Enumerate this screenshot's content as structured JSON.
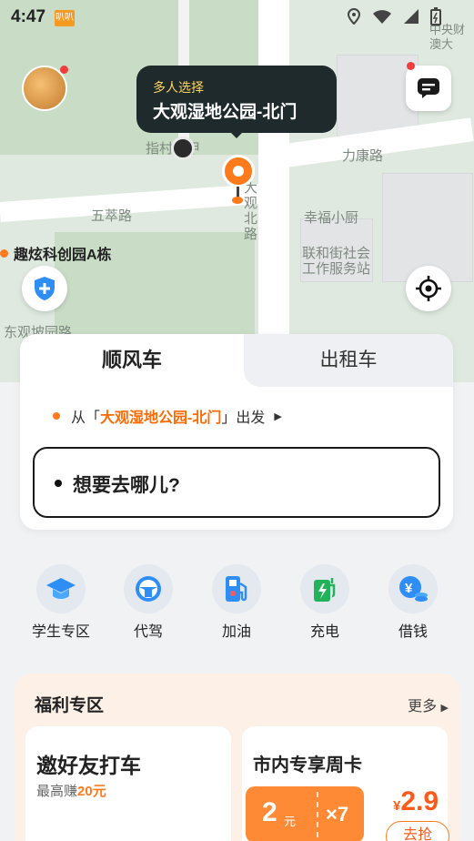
{
  "status_bar": {
    "time": "4:47",
    "notif_label": "叭叭"
  },
  "map": {
    "labels": {
      "road_likang": "力康路",
      "road_daguan": "大观北路",
      "road_left": "五萃路",
      "place_top_right": "中央财澳大",
      "place_xingfu": "幸福小厨",
      "place_lianhe": "联和街社会工作服务站",
      "place_zhicun": "指村美甲",
      "place_bottom_left": "东观坡园路"
    },
    "bubble": {
      "subtitle": "多人选择",
      "title": "大观湿地公园-北门"
    },
    "poi_label": "趣炫科创园A栋"
  },
  "ride_card": {
    "tabs": [
      "顺风车",
      "出租车"
    ],
    "from_prefix": "从「",
    "from_place": "大观湿地公园-北门",
    "from_suffix": "」出发",
    "destination_placeholder": "想要去哪儿?"
  },
  "services": [
    {
      "label": "学生专区",
      "icon": "graduation-cap-icon"
    },
    {
      "label": "代驾",
      "icon": "steering-wheel-icon"
    },
    {
      "label": "加油",
      "icon": "fuel-pump-icon"
    },
    {
      "label": "充电",
      "icon": "charging-station-icon"
    },
    {
      "label": "借钱",
      "icon": "yen-coin-icon"
    }
  ],
  "welfare": {
    "title": "福利专区",
    "more": "更多",
    "invite": {
      "title": "邀好友打车",
      "subtitle_prefix": "最高赚",
      "subtitle_amount": "20元"
    },
    "weekly": {
      "title": "市内专享周卡",
      "coupon_value": "2",
      "coupon_unit": "元",
      "coupon_count": "×7",
      "price_currency": "¥",
      "price_value": "2.9",
      "grab_label": "去抢"
    }
  },
  "colors": {
    "accent": "#ff7a1a",
    "dark_bubble": "#1f2a2d",
    "brand_blue": "#2f7df6"
  }
}
